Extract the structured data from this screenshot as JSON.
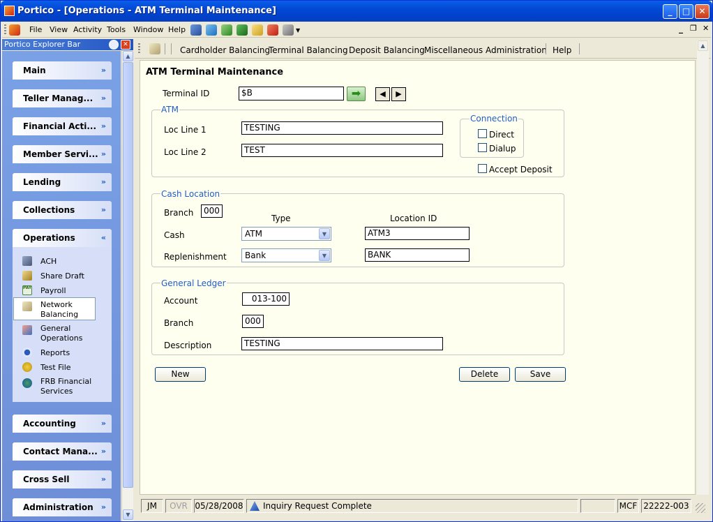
{
  "window": {
    "title": "Portico - [Operations - ATM Terminal Maintenance]",
    "minimize": "_",
    "maximize": "□",
    "close": "✕"
  },
  "menubar": {
    "items": [
      "File",
      "View",
      "Activity",
      "Tools",
      "Window",
      "Help"
    ],
    "mdi_min": "_",
    "mdi_restore": "❐",
    "mdi_close": "✕"
  },
  "explorer": {
    "title": "Portico Explorer Bar",
    "groups": {
      "main": "Main",
      "teller": "Teller Manag...",
      "financial": "Financial Acti...",
      "member": "Member Servi...",
      "lending": "Lending",
      "collections": "Collections",
      "operations": "Operations",
      "accounting": "Accounting",
      "contact": "Contact Mana...",
      "crosssell": "Cross Sell",
      "administration": "Administration"
    },
    "ops_items": {
      "ach": "ACH",
      "share_draft": "Share Draft",
      "payroll": "Payroll",
      "network1": "Network",
      "network2": "Balancing",
      "general1": "General",
      "general2": "Operations",
      "reports": "Reports",
      "testfile": "Test File",
      "frb1": "FRB Financial",
      "frb2": "Services"
    },
    "chev_down": "»",
    "chev_up": "«"
  },
  "contentmenu": {
    "items": [
      "Cardholder Balancing",
      "Terminal Balancing",
      "Deposit Balancing",
      "Miscellaneous",
      "Administration",
      "Help"
    ]
  },
  "form": {
    "title": "ATM Terminal Maintenance",
    "terminal_label": "Terminal ID",
    "terminal_value": "$B",
    "atm": {
      "legend": "ATM",
      "loc1_label": "Loc Line 1",
      "loc1_value": "TESTING",
      "loc2_label": "Loc Line 2",
      "loc2_value": "TEST",
      "connection_legend": "Connection",
      "direct": "Direct",
      "dialup": "Dialup",
      "accept_deposit": "Accept Deposit"
    },
    "cash": {
      "legend": "Cash Location",
      "branch_label": "Branch",
      "branch_value": "000",
      "type_header": "Type",
      "locid_header": "Location ID",
      "cash_label": "Cash",
      "cash_type": "ATM",
      "cash_locid": "ATM3",
      "repl_label": "Replenishment",
      "repl_type": "Bank",
      "repl_locid": "BANK"
    },
    "gl": {
      "legend": "General Ledger",
      "account_label": "Account",
      "account_value": "013-100",
      "branch_label": "Branch",
      "branch_value": "000",
      "desc_label": "Description",
      "desc_value": "TESTING"
    },
    "buttons": {
      "new": "New",
      "delete": "Delete",
      "save": "Save"
    }
  },
  "status": {
    "user": "JM",
    "ovr": "OVR",
    "date": "05/28/2008",
    "message": "Inquiry Request Complete",
    "mcf": "MCF",
    "account": "22222-003"
  }
}
